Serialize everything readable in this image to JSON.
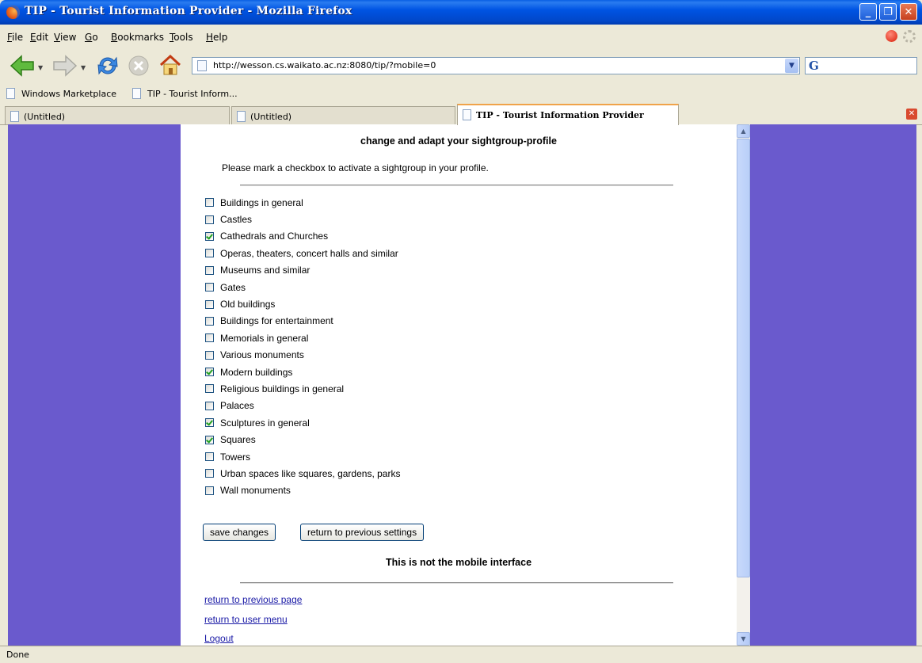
{
  "window": {
    "title": "TIP - Tourist Information Provider - Mozilla Firefox"
  },
  "menu": [
    "File",
    "Edit",
    "View",
    "Go",
    "Bookmarks",
    "Tools",
    "Help"
  ],
  "navigation": {
    "url": "http://wesson.cs.waikato.ac.nz:8080/tip/?mobile=0"
  },
  "bookmarks": [
    "Windows Marketplace",
    "TIP - Tourist Inform..."
  ],
  "tabs": [
    {
      "label": "(Untitled)",
      "active": false
    },
    {
      "label": "(Untitled)",
      "active": false
    },
    {
      "label": "TIP - Tourist Information Provider",
      "active": true
    }
  ],
  "page": {
    "heading": "change and adapt your sightgroup-profile",
    "intro": "Please mark a checkbox to activate a sightgroup in your profile.",
    "sightgroups": [
      {
        "label": "Buildings in general",
        "checked": false
      },
      {
        "label": "Castles",
        "checked": false
      },
      {
        "label": "Cathedrals and Churches",
        "checked": true
      },
      {
        "label": "Operas, theaters, concert halls and similar",
        "checked": false
      },
      {
        "label": "Museums and similar",
        "checked": false
      },
      {
        "label": "Gates",
        "checked": false
      },
      {
        "label": "Old buildings",
        "checked": false
      },
      {
        "label": "Buildings for entertainment",
        "checked": false
      },
      {
        "label": "Memorials in general",
        "checked": false
      },
      {
        "label": "Various monuments",
        "checked": false
      },
      {
        "label": "Modern buildings",
        "checked": true
      },
      {
        "label": "Religious buildings in general",
        "checked": false
      },
      {
        "label": "Palaces",
        "checked": false
      },
      {
        "label": "Sculptures in general",
        "checked": true
      },
      {
        "label": "Squares",
        "checked": true
      },
      {
        "label": "Towers",
        "checked": false
      },
      {
        "label": "Urban spaces like squares, gardens, parks",
        "checked": false
      },
      {
        "label": "Wall monuments",
        "checked": false
      }
    ],
    "save_label": "save changes",
    "revert_label": "return to previous settings",
    "mobile_note": "This is not the mobile interface",
    "links": [
      "return to previous page",
      "return to user menu",
      "Logout"
    ]
  },
  "status": {
    "text": "Done"
  },
  "colors": {
    "page_background": "#6a5acd",
    "titlebar": "#0054e3"
  }
}
